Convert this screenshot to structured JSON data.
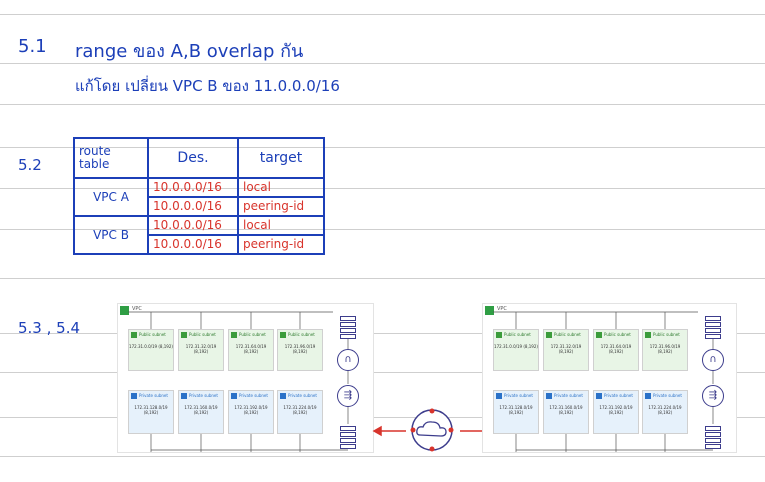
{
  "notes": {
    "s51_num": "5.1",
    "s51_line1": "range ของ A,B overlap กัน",
    "s51_line2": "แก้โดย เปลี่ยน VPC B ของ 11.0.0.0/16",
    "s52_num": "5.2",
    "s53_num": "5.3 , 5.4"
  },
  "route_table": {
    "h_route": "route table",
    "h_des": "Des.",
    "h_target": "target",
    "groups": [
      {
        "vpc": "VPC A",
        "rows": [
          {
            "des": "10.0.0.0/16",
            "target": "local"
          },
          {
            "des": "10.0.0.0/16",
            "target": "peering-id"
          }
        ]
      },
      {
        "vpc": "VPC B",
        "rows": [
          {
            "des": "10.0.0.0/16",
            "target": "local"
          },
          {
            "des": "10.0.0.0/16",
            "target": "peering-id"
          }
        ]
      }
    ]
  },
  "diagram": {
    "vpc_label": "VPC",
    "public_label": "Public subnet",
    "private_label": "Private subnet",
    "left": {
      "public_cidrs": [
        "172.31.0.0/19 (8,192)",
        "172.31.32.0/19 (8,192)",
        "172.31.64.0/19 (8,192)",
        "172.31.96.0/19 (8,192)"
      ],
      "private_cidrs": [
        "172.31.128.0/19 (8,192)",
        "172.31.160.0/19 (8,192)",
        "172.31.192.0/19 (8,192)",
        "172.31.224.0/19 (8,192)"
      ]
    },
    "right": {
      "public_cidrs": [
        "172.31.0.0/19 (8,192)",
        "172.31.32.0/19 (8,192)",
        "172.31.64.0/19 (8,192)",
        "172.31.96.0/19 (8,192)"
      ],
      "private_cidrs": [
        "172.31.128.0/19 (8,192)",
        "172.31.160.0/19 (8,192)",
        "172.31.192.0/19 (8,192)",
        "172.31.224.0/19 (8,192)"
      ]
    },
    "colors": {
      "ink_blue": "#1c3fb8",
      "ink_red": "#d8342c",
      "public_bg": "#e8f5e6",
      "private_bg": "#e6f1fb"
    },
    "icons": [
      "vpc-icon",
      "route-table-icon",
      "internet-gateway-icon",
      "nat-gateway-icon",
      "peering-cloud-icon"
    ]
  }
}
